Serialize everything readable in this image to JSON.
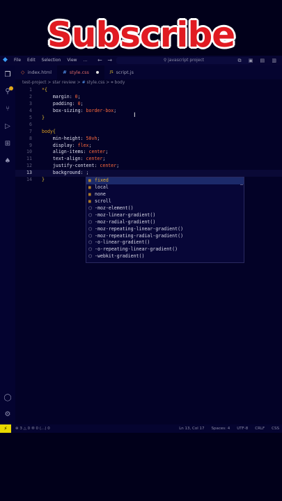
{
  "banner": {
    "text": "Subscribe"
  },
  "titlebar": {
    "menu": [
      "File",
      "Edit",
      "Selection",
      "View",
      "..."
    ],
    "nav_back": "←",
    "nav_fwd": "→",
    "search": "javascript project",
    "controls": "⧉ ▣ ▤ ▥"
  },
  "tabs": [
    {
      "icon": "◇",
      "label": "index.html"
    },
    {
      "icon": "#",
      "label": "style.css"
    },
    {
      "icon": "JS",
      "label": "script.js"
    }
  ],
  "breadcrumb": {
    "a": "test-project",
    "b": "star review",
    "c": "style.css",
    "d": "body"
  },
  "code": [
    {
      "n": "1",
      "parts": [
        [
          "sel",
          "*"
        ],
        [
          "brace",
          "{"
        ]
      ]
    },
    {
      "n": "2",
      "parts": [
        [
          "prop",
          "    margin"
        ],
        [
          "punc",
          ": "
        ],
        [
          "num",
          "0"
        ],
        [
          "punc",
          ";"
        ]
      ]
    },
    {
      "n": "3",
      "parts": [
        [
          "prop",
          "    padding"
        ],
        [
          "punc",
          ": "
        ],
        [
          "num",
          "0"
        ],
        [
          "punc",
          ";"
        ]
      ]
    },
    {
      "n": "4",
      "parts": [
        [
          "prop",
          "    box-sizing"
        ],
        [
          "punc",
          ": "
        ],
        [
          "val",
          "border-box"
        ],
        [
          "punc",
          ";"
        ]
      ]
    },
    {
      "n": "5",
      "parts": [
        [
          "brace",
          "}"
        ]
      ]
    },
    {
      "n": "6",
      "parts": []
    },
    {
      "n": "7",
      "parts": [
        [
          "sel",
          "body"
        ],
        [
          "brace",
          "{"
        ]
      ]
    },
    {
      "n": "8",
      "parts": [
        [
          "prop",
          "    min-height"
        ],
        [
          "punc",
          ": "
        ],
        [
          "num",
          "50vh"
        ],
        [
          "punc",
          ";"
        ]
      ]
    },
    {
      "n": "9",
      "parts": [
        [
          "prop",
          "    display"
        ],
        [
          "punc",
          ": "
        ],
        [
          "val",
          "flex"
        ],
        [
          "punc",
          ";"
        ]
      ]
    },
    {
      "n": "10",
      "parts": [
        [
          "prop",
          "    align-items"
        ],
        [
          "punc",
          ": "
        ],
        [
          "val",
          "center"
        ],
        [
          "punc",
          ";"
        ]
      ]
    },
    {
      "n": "11",
      "parts": [
        [
          "prop",
          "    text-align"
        ],
        [
          "punc",
          ": "
        ],
        [
          "val",
          "center"
        ],
        [
          "punc",
          ";"
        ]
      ]
    },
    {
      "n": "12",
      "parts": [
        [
          "prop",
          "    justify-content"
        ],
        [
          "punc",
          ": "
        ],
        [
          "val",
          "center"
        ],
        [
          "punc",
          ";"
        ]
      ]
    },
    {
      "n": "13",
      "parts": [
        [
          "prop",
          "    background"
        ],
        [
          "punc",
          ": ;"
        ]
      ]
    },
    {
      "n": "14",
      "parts": [
        [
          "brace",
          "}"
        ]
      ]
    }
  ],
  "current_line": "13",
  "suggestions": [
    {
      "label": "fixed",
      "kind": "value"
    },
    {
      "label": "local",
      "kind": "value"
    },
    {
      "label": "none",
      "kind": "value"
    },
    {
      "label": "scroll",
      "kind": "value"
    },
    {
      "label": "-moz-element()",
      "kind": "function"
    },
    {
      "label": "-moz-linear-gradient()",
      "kind": "function"
    },
    {
      "label": "-moz-radial-gradient()",
      "kind": "function"
    },
    {
      "label": "-moz-repeating-linear-gradient()",
      "kind": "function"
    },
    {
      "label": "-moz-repeating-radial-gradient()",
      "kind": "function"
    },
    {
      "label": "-o-linear-gradient()",
      "kind": "function"
    },
    {
      "label": "-o-repeating-linear-gradient()",
      "kind": "function"
    },
    {
      "label": "-webkit-gradient()",
      "kind": "function"
    }
  ],
  "status": {
    "remote": "⚡",
    "left": "⊗ 3 △ 0   ⑧ 0   ⟨…⟩ 0",
    "position": "Ln 13, Col 17",
    "spaces": "Spaces: 4",
    "encoding": "UTF-8",
    "eol": "CRLF",
    "language": "CSS"
  }
}
